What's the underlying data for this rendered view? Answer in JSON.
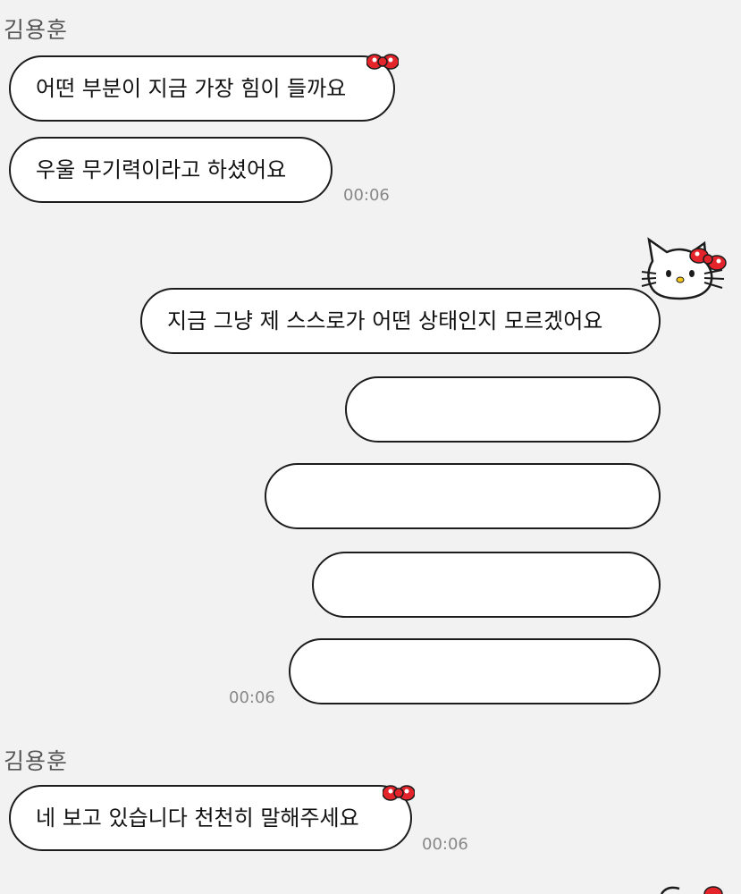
{
  "chat": {
    "sender_name_1": "김용훈",
    "sender_name_2": "김용훈",
    "incoming_1": {
      "messages": [
        "어떤 부분이 지금 가장 힘이 들까요",
        "우울 무기력이라고 하셨어요"
      ],
      "time": "00:06"
    },
    "outgoing": {
      "message": "지금 그냥 제 스스로가 어떤 상태인지 모르겠어요",
      "time": "00:06"
    },
    "incoming_2": {
      "message": "네 보고 있습니다 천천히 말해주세요",
      "time": "00:06"
    }
  },
  "colors": {
    "background": "#f2f2f2",
    "bubble": "#ffffff",
    "border": "#1c1c1c",
    "bow": "#e3242b",
    "time_text": "#888888"
  },
  "icons": {
    "bow": "bow-icon",
    "avatar": "hello-kitty-avatar"
  }
}
